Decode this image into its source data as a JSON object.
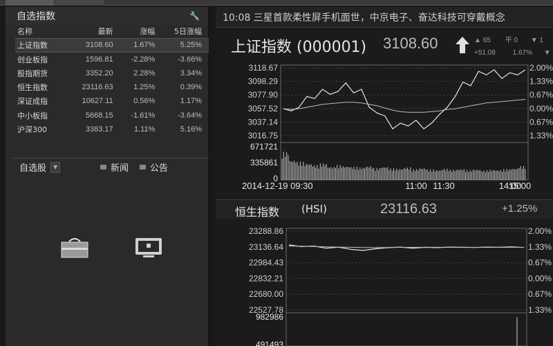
{
  "watchlist": {
    "title": "自选指数",
    "columns": [
      "名称",
      "最新",
      "涨幅",
      "5日涨幅"
    ],
    "rows": [
      {
        "name": "上证指数",
        "last": "3108.60",
        "chg": "1.67%",
        "chg5": "5.25%"
      },
      {
        "name": "创业板指",
        "last": "1596.81",
        "chg": "-2.28%",
        "chg5": "-3.66%"
      },
      {
        "name": "股指期货",
        "last": "3352.20",
        "chg": "2.28%",
        "chg5": "3.34%"
      },
      {
        "name": "恒生指数",
        "last": "23116.63",
        "chg": "1.25%",
        "chg5": "0.39%"
      },
      {
        "name": "深证成指",
        "last": "10627.11",
        "chg": "0.56%",
        "chg5": "1.17%"
      },
      {
        "name": "中小板指",
        "last": "5668.15",
        "chg": "-1.61%",
        "chg5": "-3.64%"
      },
      {
        "name": "沪深300",
        "last": "3383.17",
        "chg": "1.11%",
        "chg5": "5.16%"
      }
    ]
  },
  "bottom_bar": {
    "stocks_label": "自选股",
    "dropdown_icon": "chevron-down-icon",
    "news_label": "新闻",
    "announce_label": "公告"
  },
  "ticker": "10:08 三星首款柔性屏手机面世，中京电子、奋达科技可穿戴概念",
  "sse": {
    "name": "上证指数 (000001)",
    "price": "3108.60",
    "trend_icon": "up-arrow-icon",
    "up_count": "65",
    "flat_label": "平",
    "flat_count": "0",
    "change": "+51.08",
    "pct": "1.67%",
    "extra": "1"
  },
  "hsi": {
    "name": "恒生指数",
    "code": "(HSI)",
    "price": "23116.63",
    "pct": "+1.25%"
  },
  "colors": {
    "bg": "#1a1818",
    "line": "#d8d8d8",
    "grid": "#555555",
    "accent_up": "#e0e0e0"
  },
  "chart_data": [
    {
      "type": "line",
      "title": "上证指数 (000001)",
      "x_ticks": [
        "2014-12-19 09:30",
        "11:00",
        "11:30",
        "14:00",
        "15:00"
      ],
      "y_ticks_left": [
        "3118.67",
        "3098.29",
        "3077.90",
        "3057.52",
        "3037.14",
        "3016.75"
      ],
      "y_ticks_right": [
        "2.00%",
        "1.33%",
        "0.67%",
        "0.00%",
        "0.67%",
        "1.33%"
      ],
      "ylim": [
        3016.75,
        3118.67
      ],
      "volume_ticks": [
        "671721",
        "335861",
        "0"
      ],
      "series": [
        {
          "values": [
            3058,
            3055,
            3060,
            3075,
            3072,
            3085,
            3078,
            3082,
            3094,
            3080,
            3085,
            3060,
            3052,
            3048,
            3030,
            3038,
            3034,
            3042,
            3030,
            3038,
            3050,
            3060,
            3075,
            3095,
            3090,
            3110,
            3105,
            3112,
            3100,
            3108,
            3105,
            3112
          ]
        },
        {
          "values": [
            3058,
            3057,
            3058,
            3060,
            3062,
            3064,
            3065,
            3066,
            3067,
            3067,
            3066,
            3064,
            3062,
            3059,
            3056,
            3054,
            3053,
            3053,
            3053,
            3054,
            3055,
            3057,
            3058,
            3060,
            3062,
            3064,
            3066,
            3067,
            3068,
            3069,
            3070,
            3071
          ]
        }
      ],
      "volume": [
        0.85,
        0.6,
        0.55,
        0.5,
        0.45,
        0.5,
        0.4,
        0.45,
        0.42,
        0.4,
        0.38,
        0.42,
        0.36,
        0.4,
        0.35,
        0.34,
        0.38,
        0.33,
        0.36,
        0.32,
        0.3,
        0.34,
        0.31,
        0.33,
        0.3,
        0.32,
        0.29,
        0.31,
        0.3,
        0.33,
        0.35,
        0.42
      ]
    },
    {
      "type": "line",
      "title": "恒生指数 (HSI)",
      "y_ticks_left": [
        "23288.86",
        "23136.64",
        "22984.43",
        "22832.21",
        "22680.00",
        "22527.78"
      ],
      "y_ticks_right": [
        "2.00%",
        "1.33%",
        "0.67%",
        "0.00%",
        "0.67%",
        "1.33%"
      ],
      "ylim": [
        22527.78,
        23288.86
      ],
      "volume_ticks": [
        "982986",
        "491493"
      ],
      "series": [
        {
          "values": [
            23140,
            23125,
            23130,
            23110,
            23120,
            23100,
            23090,
            23105,
            23115,
            23120,
            23110,
            23118,
            23115,
            23120,
            23118,
            23116,
            23120,
            23118,
            23122,
            23116
          ]
        },
        {
          "values": [
            23130,
            23128,
            23126,
            23122,
            23120,
            23118,
            23116,
            23115,
            23116,
            23117,
            23117,
            23118,
            23118,
            23118,
            23118,
            23117,
            23117,
            23117,
            23118,
            23117
          ]
        }
      ]
    }
  ]
}
